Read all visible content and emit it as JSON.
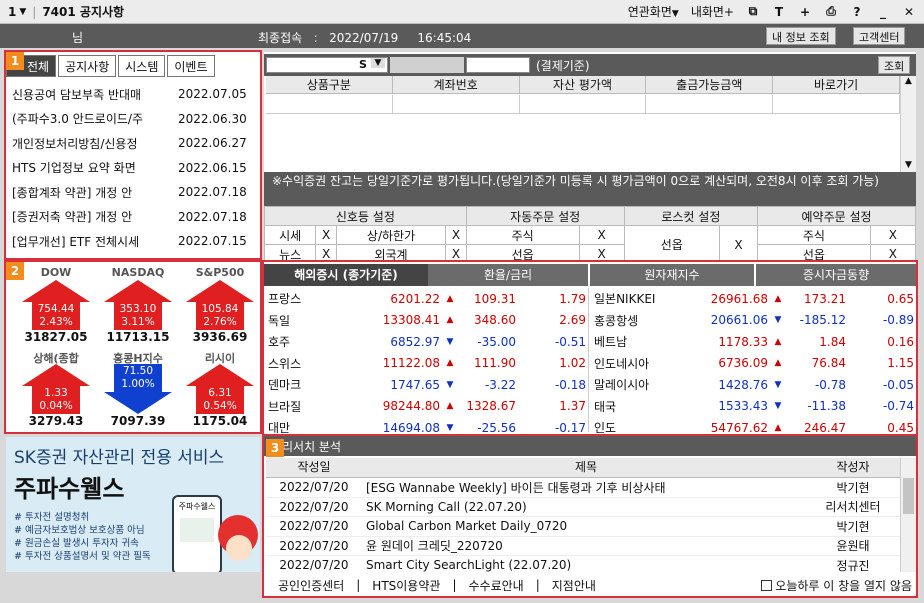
{
  "window": {
    "number": "1",
    "title": "7401 공지사항",
    "menu_related": "연관화면",
    "menu_mine": "내화면+",
    "icons": [
      "monitor-icon",
      "text-icon",
      "plus-icon",
      "print-icon",
      "help-icon",
      "minimize-icon",
      "close-icon"
    ]
  },
  "header": {
    "name_suffix": "님",
    "last_access_label": "최종접속",
    "last_access_sep": ":",
    "last_access_date": "2022/07/19",
    "last_access_time": "16:45:04",
    "btn_myinfo": "내 정보 조회",
    "btn_center": "고객센터"
  },
  "badges": {
    "b1": "1",
    "b2": "2",
    "b3": "3"
  },
  "notices": {
    "tabs": [
      "전체",
      "공지사항",
      "시스템",
      "이벤트"
    ],
    "items": [
      {
        "title": "신용공여 담보부족 반대매",
        "date": "2022.07.05"
      },
      {
        "title": "(주파수3.0 안드로이드/주",
        "date": "2022.06.30"
      },
      {
        "title": "개인정보처리방침/신용정",
        "date": "2022.06.27"
      },
      {
        "title": "HTS 기업정보 요약 화면",
        "date": "2022.06.15"
      },
      {
        "title": "[종합계좌 약관] 개정 안",
        "date": "2022.07.18"
      },
      {
        "title": "[증권저축 약관] 개정 안",
        "date": "2022.07.18"
      },
      {
        "title": "[업무개선] ETF 전체시세",
        "date": "2022.07.15"
      }
    ]
  },
  "indices": [
    {
      "name": "DOW",
      "change": "754.44",
      "pct": "2.43%",
      "value": "31827.05",
      "dir": "up"
    },
    {
      "name": "NASDAQ",
      "change": "353.10",
      "pct": "3.11%",
      "value": "11713.15",
      "dir": "up"
    },
    {
      "name": "S&P500",
      "change": "105.84",
      "pct": "2.76%",
      "value": "3936.69",
      "dir": "up"
    },
    {
      "name": "상해(종합",
      "change": "1.33",
      "pct": "0.04%",
      "value": "3279.43",
      "dir": "up"
    },
    {
      "name": "홍콩H지수",
      "change": "71.50",
      "pct": "1.00%",
      "value": "7097.39",
      "dir": "down"
    },
    {
      "name": "리시이",
      "change": "6.31",
      "pct": "0.54%",
      "value": "1175.04",
      "dir": "up"
    }
  ],
  "account": {
    "select_s": "S",
    "basis_label": "(결제기준)",
    "btn_query": "조회",
    "columns": [
      "상품구분",
      "계좌번호",
      "자산 평가액",
      "출금가능금액",
      "바로가기"
    ],
    "note": "※수익증권 잔고는 당일기준가로 평가됩니다.(당일기준가 미등록 시 평가금액이 0으로 계산되며, 오전8시 이후 조회 가능)"
  },
  "options": {
    "groups": [
      "신호등 설정",
      "자동주문 설정",
      "로스컷 설정",
      "예약주문 설정"
    ],
    "row1": [
      "시세",
      "X",
      "상/하한가",
      "X",
      "주식",
      "X",
      "선옵",
      "X",
      "주식",
      "X"
    ],
    "row2": [
      "뉴스",
      "X",
      "외국계",
      "X",
      "선옵",
      "X",
      "선옵",
      "X"
    ]
  },
  "market": {
    "tab_overseas": "해외증시 (종가기준)",
    "tab_fx": "환율/금리",
    "tab_commodity": "원자재지수",
    "tab_funds": "증시자금동향",
    "left": [
      {
        "name": "프랑스",
        "price": "6201.22",
        "dir": "up",
        "chg": "109.31",
        "pct": "1.79"
      },
      {
        "name": "독일",
        "price": "13308.41",
        "dir": "up",
        "chg": "348.60",
        "pct": "2.69"
      },
      {
        "name": "호주",
        "price": "6852.97",
        "dir": "down",
        "chg": "-35.00",
        "pct": "-0.51"
      },
      {
        "name": "스위스",
        "price": "11122.08",
        "dir": "up",
        "chg": "111.90",
        "pct": "1.02"
      },
      {
        "name": "덴마크",
        "price": "1747.65",
        "dir": "down",
        "chg": "-3.22",
        "pct": "-0.18"
      },
      {
        "name": "브라질",
        "price": "98244.80",
        "dir": "up",
        "chg": "1328.67",
        "pct": "1.37"
      },
      {
        "name": "대만",
        "price": "14694.08",
        "dir": "down",
        "chg": "-25.56",
        "pct": "-0.17"
      }
    ],
    "right": [
      {
        "name": "일본NIKKEI",
        "price": "26961.68",
        "dir": "up",
        "chg": "173.21",
        "pct": "0.65"
      },
      {
        "name": "홍콩항셍",
        "price": "20661.06",
        "dir": "down",
        "chg": "-185.12",
        "pct": "-0.89"
      },
      {
        "name": "베트남",
        "price": "1178.33",
        "dir": "up",
        "chg": "1.84",
        "pct": "0.16"
      },
      {
        "name": "인도네시아",
        "price": "6736.09",
        "dir": "up",
        "chg": "76.84",
        "pct": "1.15"
      },
      {
        "name": "말레이시아",
        "price": "1428.76",
        "dir": "down",
        "chg": "-0.78",
        "pct": "-0.05"
      },
      {
        "name": "태국",
        "price": "1533.43",
        "dir": "down",
        "chg": "-11.38",
        "pct": "-0.74"
      },
      {
        "name": "인도",
        "price": "54767.62",
        "dir": "up",
        "chg": "246.47",
        "pct": "0.45"
      }
    ]
  },
  "research": {
    "title": "리서치 분석",
    "columns": [
      "작성일",
      "제목",
      "작성자"
    ],
    "rows": [
      {
        "date": "2022/07/20",
        "title": "[ESG Wannabe Weekly] 바이든 대통령과 기후 비상사태",
        "author": "박기현"
      },
      {
        "date": "2022/07/20",
        "title": "SK Morning Call (22.07.20)",
        "author": "리서치센터"
      },
      {
        "date": "2022/07/20",
        "title": "Global Carbon Market Daily_0720",
        "author": "박기현"
      },
      {
        "date": "2022/07/20",
        "title": "윤 원데이 크레딧_220720",
        "author": "윤원태"
      },
      {
        "date": "2022/07/20",
        "title": "Smart City SearchLight (22.07.20)",
        "author": "정규진"
      }
    ]
  },
  "footer": {
    "links": [
      "공인인증센터",
      "HTS이용약관",
      "수수료안내",
      "지점안내"
    ],
    "sep": "|",
    "checkbox_label": "오늘하루 이 창을 열지 않음"
  },
  "banner": {
    "title": "SK증권 자산관리 전용 서비스",
    "brand": "주파수웰스",
    "bullets": [
      "# 투자전 설명청취",
      "# 예금자보호법상 보호상품 아님",
      "# 원금손실 발생시 투자자 귀속",
      "# 투자전 상품설명서 및 약관 필독"
    ],
    "phone_text": "주파수웰스"
  }
}
